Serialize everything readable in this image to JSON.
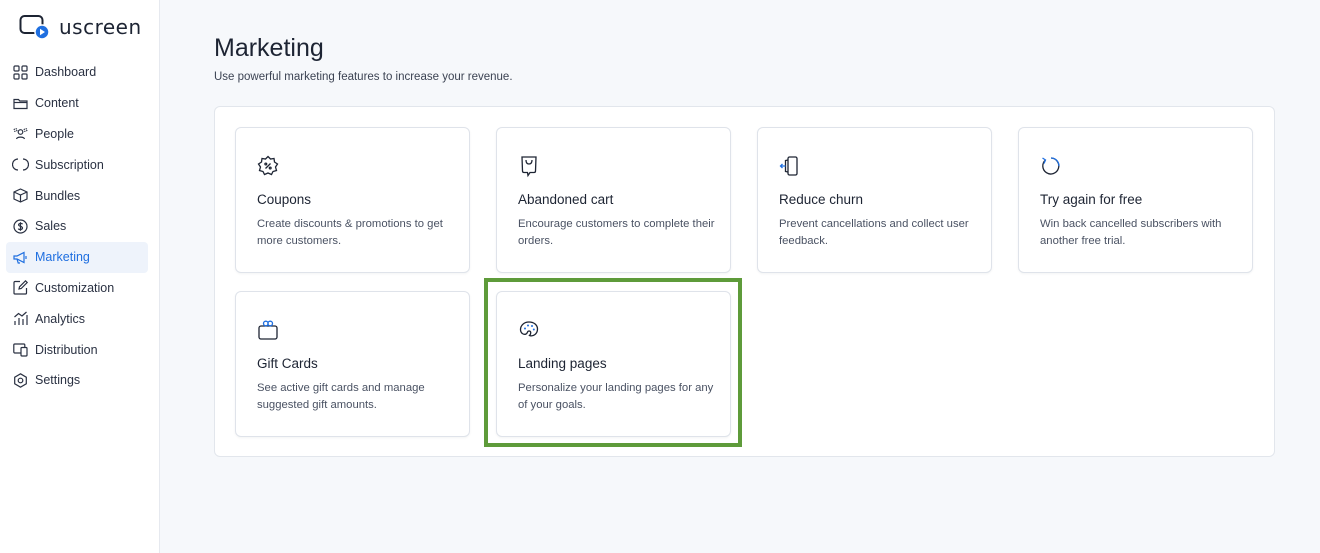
{
  "app": {
    "logo_text": "uscreen",
    "accent_color": "#1f6fe0",
    "highlight_color": "#5e9b3a"
  },
  "sidebar": {
    "items": [
      {
        "label": "Dashboard",
        "icon": "dashboard-grid-icon"
      },
      {
        "label": "Content",
        "icon": "folder-icon"
      },
      {
        "label": "People",
        "icon": "people-icon"
      },
      {
        "label": "Subscription",
        "icon": "subscription-cycle-icon"
      },
      {
        "label": "Bundles",
        "icon": "bundle-box-icon"
      },
      {
        "label": "Sales",
        "icon": "dollar-circle-icon"
      },
      {
        "label": "Marketing",
        "icon": "megaphone-icon",
        "active": true
      },
      {
        "label": "Customization",
        "icon": "edit-square-icon"
      },
      {
        "label": "Analytics",
        "icon": "analytics-bars-icon"
      },
      {
        "label": "Distribution",
        "icon": "distribution-devices-icon"
      },
      {
        "label": "Settings",
        "icon": "settings-gear-icon"
      }
    ]
  },
  "page": {
    "title": "Marketing",
    "subtitle": "Use powerful marketing features to increase your revenue."
  },
  "cards": [
    {
      "title": "Coupons",
      "description": "Create discounts & promotions to get more customers.",
      "icon": "coupon-percent-icon"
    },
    {
      "title": "Abandoned cart",
      "description": "Encourage customers to complete their orders.",
      "icon": "shopping-bag-icon"
    },
    {
      "title": "Reduce churn",
      "description": "Prevent cancellations and collect user feedback.",
      "icon": "exit-door-icon"
    },
    {
      "title": "Try again for free",
      "description": "Win back cancelled subscribers with another free trial.",
      "icon": "retry-cycle-icon"
    },
    {
      "title": "Gift Cards",
      "description": "See active gift cards and manage suggested gift amounts.",
      "icon": "gift-icon"
    },
    {
      "title": "Landing pages",
      "description": "Personalize your landing pages for any of your goals.",
      "icon": "palette-icon",
      "highlighted": true
    }
  ]
}
